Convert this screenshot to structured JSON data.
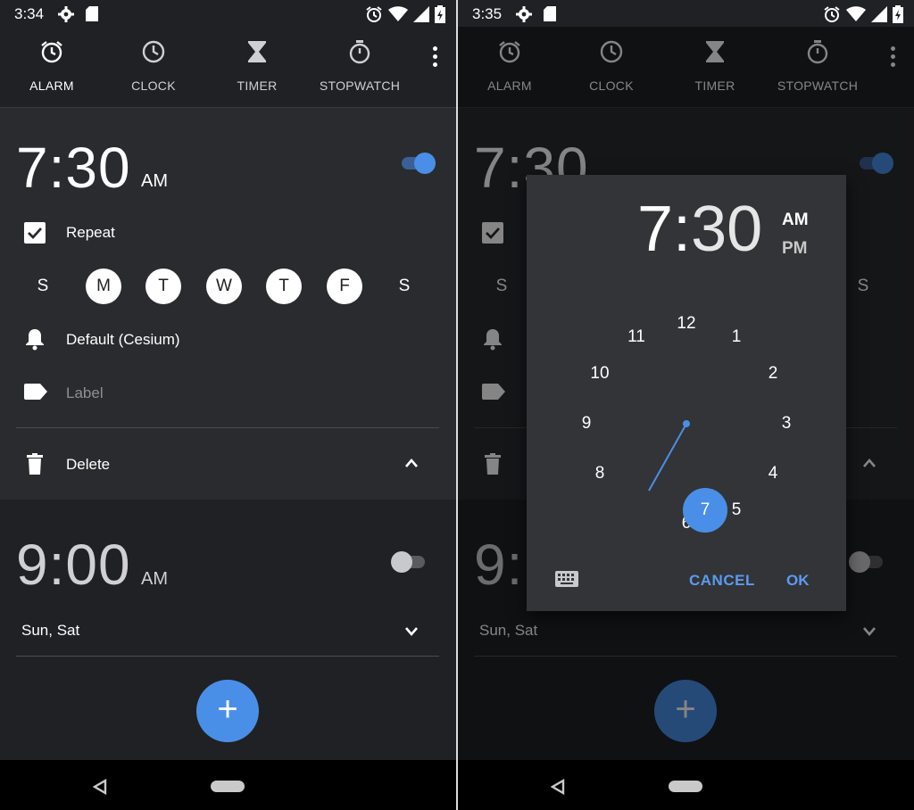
{
  "left": {
    "status": {
      "time": "3:34"
    },
    "tabs": [
      {
        "label": "ALARM",
        "icon": "alarm-icon"
      },
      {
        "label": "CLOCK",
        "icon": "clock-icon"
      },
      {
        "label": "TIMER",
        "icon": "hourglass-icon"
      },
      {
        "label": "STOPWATCH",
        "icon": "stopwatch-icon"
      }
    ],
    "alarm1": {
      "time": "7:30",
      "ampm": "AM",
      "enabled": true,
      "repeat_label": "Repeat",
      "days": [
        "S",
        "M",
        "T",
        "W",
        "T",
        "F",
        "S"
      ],
      "days_on": [
        false,
        true,
        true,
        true,
        true,
        true,
        false
      ],
      "ringtone": "Default (Cesium)",
      "label_placeholder": "Label",
      "delete_label": "Delete"
    },
    "alarm2": {
      "time": "9:00",
      "ampm": "AM",
      "enabled": false,
      "days_summary": "Sun, Sat"
    },
    "fab_label": "+"
  },
  "right": {
    "status": {
      "time": "3:35"
    },
    "tabs": [
      {
        "label": "ALARM"
      },
      {
        "label": "CLOCK"
      },
      {
        "label": "TIMER"
      },
      {
        "label": "STOPWATCH"
      }
    ],
    "alarm1": {
      "time_partial": "7:30",
      "days_edge": [
        "S",
        "S"
      ]
    },
    "alarm2": {
      "time_partial": "9:",
      "days_summary": "Sun, Sat"
    },
    "fab_label": "+",
    "dialog": {
      "hour": "7",
      "colon": ":",
      "minutes": "30",
      "am": "AM",
      "pm": "PM",
      "selected_period": "AM",
      "numbers": [
        "12",
        "1",
        "2",
        "3",
        "4",
        "5",
        "6",
        "7",
        "8",
        "9",
        "10",
        "11"
      ],
      "selected_hour": "7",
      "cancel_label": "CANCEL",
      "ok_label": "OK"
    }
  },
  "colors": {
    "accent": "#4a8fe7",
    "background": "#202124",
    "card": "#2a2b2e",
    "dialog": "#333437"
  }
}
